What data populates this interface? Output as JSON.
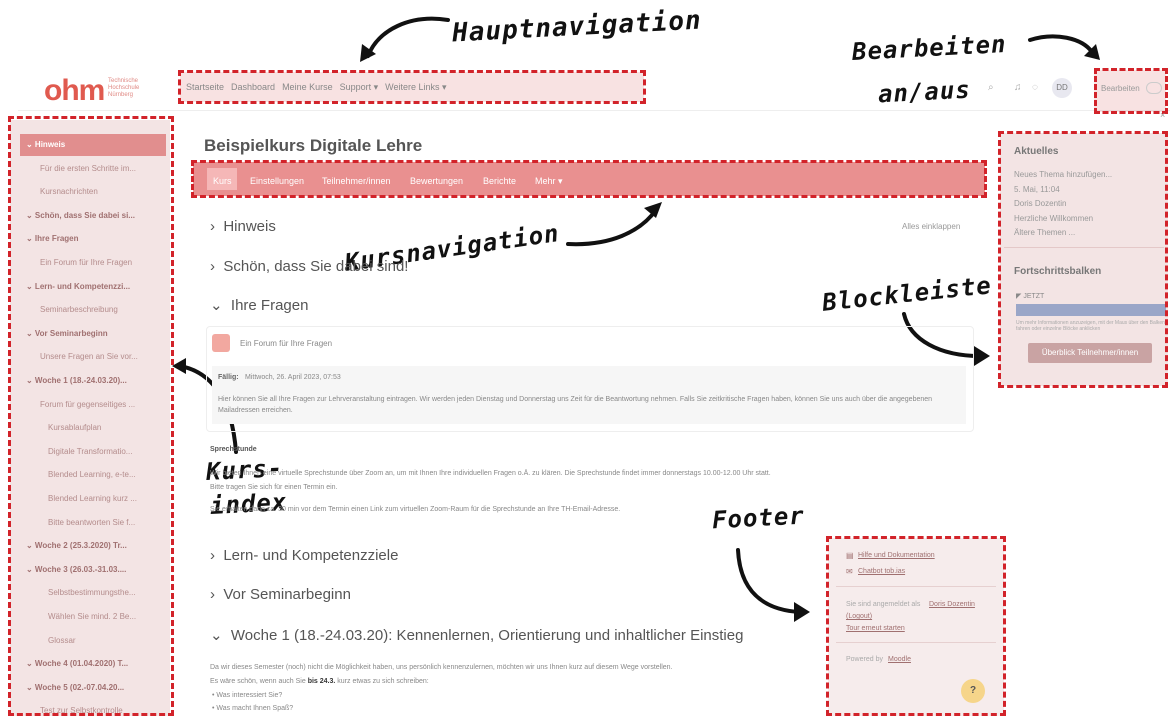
{
  "annotations": {
    "main_nav": "Hauptnavigation",
    "edit_toggle_1": "Bearbeiten",
    "edit_toggle_2": "an/aus",
    "course_nav": "Kursnavigation",
    "block_bar": "Blockleiste",
    "course_index_1": "Kurs-",
    "course_index_2": "index",
    "footer": "Footer"
  },
  "header": {
    "logo": "ohm",
    "logo_sub": [
      "Technische",
      "Hochschule",
      "Nürnberg"
    ],
    "nav": [
      "Startseite",
      "Dashboard",
      "Meine Kurse",
      "Support ▾",
      "Weitere Links ▾"
    ],
    "user_initials": "DD",
    "edit_label": "Bearbeiten"
  },
  "course_index": {
    "items": [
      {
        "label": "Hinweis",
        "section": true,
        "active": true
      },
      {
        "label": "Für die ersten Schritte im...",
        "section": false
      },
      {
        "label": "Kursnachrichten",
        "section": false
      },
      {
        "label": "Schön, dass Sie dabei si...",
        "section": true
      },
      {
        "label": "Ihre Fragen",
        "section": true
      },
      {
        "label": "Ein Forum für Ihre Fragen",
        "section": false
      },
      {
        "label": "Lern- und Kompetenzzi...",
        "section": true
      },
      {
        "label": "Seminarbeschreibung",
        "section": false
      },
      {
        "label": "Vor Seminarbeginn",
        "section": true
      },
      {
        "label": "Unsere Fragen an Sie vor...",
        "section": false
      },
      {
        "label": "Woche 1 (18.-24.03.20)...",
        "section": true
      },
      {
        "label": "Forum für gegenseitiges ...",
        "section": false
      },
      {
        "label": "Kursablaufplan",
        "section": false
      },
      {
        "label": "Digitale Transformatio...",
        "section": false
      },
      {
        "label": "Blended Learning, e-te...",
        "section": false
      },
      {
        "label": "Blended Learning kurz ...",
        "section": false
      },
      {
        "label": "Bitte beantworten Sie f...",
        "section": false
      },
      {
        "label": "Woche 2 (25.3.2020) Tr...",
        "section": true
      },
      {
        "label": "Woche 3 (26.03.-31.03....",
        "section": true
      },
      {
        "label": "Selbstbestimmungsthe...",
        "section": false
      },
      {
        "label": "Wählen Sie mind. 2 Be...",
        "section": false
      },
      {
        "label": "Glossar",
        "section": false
      },
      {
        "label": "Woche 4 (01.04.2020) T...",
        "section": true
      },
      {
        "label": "Woche 5 (02.-07.04.20...",
        "section": true
      },
      {
        "label": "Test zur Selbstkontrolle",
        "section": false
      }
    ]
  },
  "main": {
    "title": "Beispielkurs Digitale Lehre",
    "tabs": [
      "Kurs",
      "Einstellungen",
      "Teilnehmer/innen",
      "Bewertungen",
      "Berichte",
      "Mehr ▾"
    ],
    "collapse_all": "Alles einklappen",
    "sections": {
      "hinweis": "Hinweis",
      "schoen": "Schön, dass Sie dabei sind!",
      "fragen": "Ihre Fragen",
      "lern": "Lern- und Kompetenzziele",
      "vor": "Vor Seminarbeginn",
      "woche1": "Woche 1 (18.-24.03.20): Kennenlernen, Orientierung und inhaltlicher Einstieg"
    },
    "forum_label": "Ein Forum für Ihre Fragen",
    "due_label": "Fällig:",
    "due_date": "Mittwoch, 26. April 2023, 07:53",
    "forum_text": "Hier können Sie all Ihre Fragen zur Lehrveranstaltung eintragen. Wir werden jeden Dienstag und Donnerstag uns Zeit für die Beantwortung nehmen. Falls Sie zeitkritische Fragen haben, können Sie uns auch über die angegebenen Mailadressen erreichen.",
    "office_title": "Sprechstunde",
    "office_text_1": "Wir bieten Ihnen eine virtuelle Sprechstunde über Zoom an, um mit Ihnen Ihre individuellen Fragen o.Ä. zu klären. Die Sprechstunde findet immer donnerstags 10.00-12.00 Uhr statt.",
    "office_text_2": "Bitte tragen Sie sich für einen Termin ein.",
    "office_text_3": "Sie erhalten dann ca. 30 min vor dem Termin einen Link zum virtuellen Zoom-Raum für die Sprechstunde an Ihre TH-Email-Adresse.",
    "w1_text": "Da wir dieses Semester (noch) nicht die Möglichkeit haben, uns persönlich kennenzulernen, möchten wir uns Ihnen kurz auf diesem Wege vorstellen.",
    "w1_text2a": "Es wäre schön, wenn auch Sie",
    "w1_text2b": "bis 24.3.",
    "w1_text2c": "kurz etwas zu sich schreiben:",
    "bullets": [
      "Was interessiert Sie?",
      "Was macht Ihnen Spaß?"
    ]
  },
  "blocks": {
    "news_title": "Aktuelles",
    "news_items": [
      "Neues Thema hinzufügen...",
      "5. Mai, 11:04",
      "Doris Dozentin",
      "Herzliche Willkommen",
      "Ältere Themen ..."
    ],
    "progress_title": "Fortschrittsbalken",
    "progress_now": "JETZT",
    "progress_hint": "Um mehr Informationen anzuzeigen, mit der Maus über den Balken fahren oder einzelne Blöcke anklicken",
    "progress_button": "Überblick Teilnehmer/innen"
  },
  "footer": {
    "help": "Hilfe und Dokumentation",
    "chatbot": "Chatbot tob.ias",
    "logged_in_prefix": "Sie sind angemeldet als",
    "user": "Doris Dozentin",
    "logout": "(Logout)",
    "tour": "Tour erneut starten",
    "powered_prefix": "Powered by",
    "moodle": "Moodle",
    "help_button": "?"
  }
}
